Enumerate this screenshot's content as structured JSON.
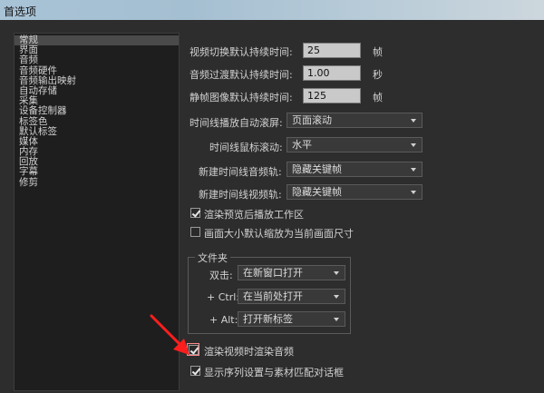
{
  "window": {
    "title": "首选项"
  },
  "sidebar": {
    "items": [
      {
        "label": "常规",
        "selected": true
      },
      {
        "label": "界面"
      },
      {
        "label": "音频"
      },
      {
        "label": "音频硬件"
      },
      {
        "label": "音频输出映射"
      },
      {
        "label": "自动存储"
      },
      {
        "label": "采集"
      },
      {
        "label": "设备控制器"
      },
      {
        "label": "标签色"
      },
      {
        "label": "默认标签"
      },
      {
        "label": "媒体"
      },
      {
        "label": "内存"
      },
      {
        "label": "回放"
      },
      {
        "label": "字幕"
      },
      {
        "label": "修剪"
      }
    ]
  },
  "durations": {
    "video_transition": {
      "label": "视频切换默认持续时间:",
      "value": "25",
      "unit": "帧"
    },
    "audio_transition": {
      "label": "音频过渡默认持续时间:",
      "value": "1.00",
      "unit": "秒"
    },
    "still_image": {
      "label": "静帧图像默认持续时间:",
      "value": "125",
      "unit": "帧"
    }
  },
  "timeline": {
    "autoscroll": {
      "label": "时间线播放自动滚屏:",
      "value": "页面滚动"
    },
    "mouse_scroll": {
      "label": "时间线鼠标滚动:",
      "value": "水平"
    },
    "new_audio_track": {
      "label": "新建时间线音频轨:",
      "value": "隐藏关键帧"
    },
    "new_video_track": {
      "label": "新建时间线视频轨:",
      "value": "隐藏关键帧"
    }
  },
  "checks": {
    "render_preview": {
      "label": "渲染预览后播放工作区",
      "checked": true
    },
    "scale_frame": {
      "label": "画面大小默认缩放为当前画面尺寸",
      "checked": false
    },
    "render_audio": {
      "label": "渲染视频时渲染音频",
      "checked": true
    },
    "show_sequence": {
      "label": "显示序列设置与素材匹配对话框",
      "checked": true
    }
  },
  "bins": {
    "title": "文件夹",
    "double_click": {
      "label": "双击:",
      "value": "在新窗口打开"
    },
    "ctrl": {
      "label": "+ Ctrl:",
      "value": "在当前处打开"
    },
    "alt": {
      "label": "+ Alt:",
      "value": "打开新标签"
    }
  },
  "colors": {
    "annotation_arrow": "#ff1e1e",
    "panel_bg": "#2d2d2d"
  }
}
